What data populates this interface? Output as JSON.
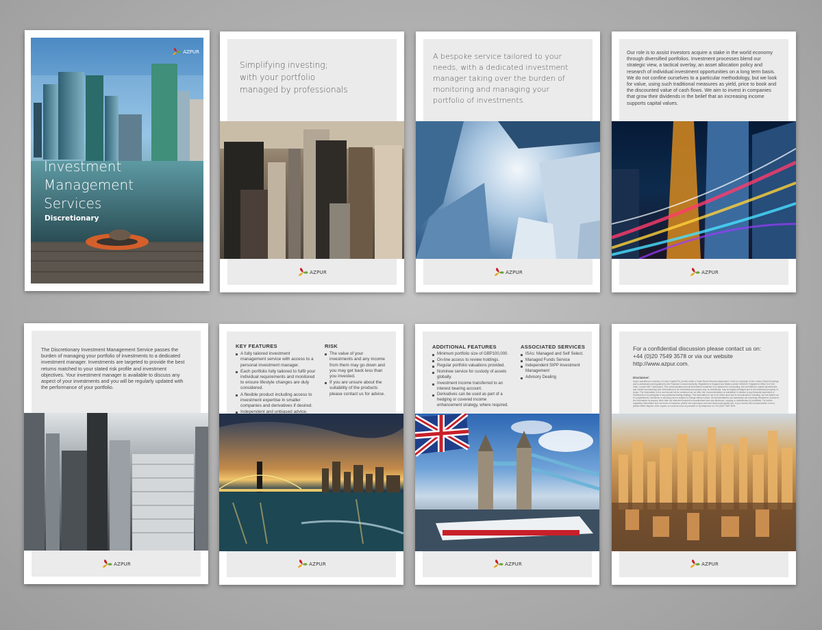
{
  "brand": {
    "logo_text": "AZPUR"
  },
  "cover": {
    "title_lines": [
      "Investment",
      "Management",
      "Services"
    ],
    "subtitle": "Discretionary"
  },
  "page2": {
    "headline_lines": [
      "Simplifying investing;",
      "with your portfolio",
      "managed by professionals"
    ]
  },
  "page3": {
    "headline_lines": [
      "A bespoke service tailored to your",
      "needs, with a dedicated investment",
      "manager taking over the burden of",
      "monitoring and managing your",
      "portfolio of investments."
    ]
  },
  "page4": {
    "text": "Our role is to assist investors acquire a stake in the world economy through diversified portfolios. Investment processes blend our strategic view, a tactical overlay, an asset allocation policy and research of individual investment opportunities on a long term basis. We do not confine ourselves to a particular methodology, but we look for value, using such traditional measures as yield, price to book and the discounted value of cash flows. We aim to invest in companies that grow their dividends in the belief that an increasing income supports capital values."
  },
  "page5": {
    "text": "The Discretionary Investment Management Service passes the burden of managing your portfolio of investments to a dedicated investment manager.  Investments are targeted to provide the best returns matched to your stated risk profile and investment objectives. Your investment manager is available to discuss any aspect of your investments and you will be regularly updated with the performance of your portfolio."
  },
  "page6": {
    "key_features_title": "KEY FEATURES",
    "key_features": [
      "A fully tailored investment management service with access to a personal investment manager.",
      "Each portfolio fully tailored to fulfil your individual requirements and monitored to ensure lifestyle changes are duly considered.",
      "A flexible product including access to investment expertise in smaller companies and derivatives if desired.",
      "Independent and unbiased advice."
    ],
    "risk_title": "RISK",
    "risk": [
      "The value of your investments and any income from them may go down and you may get back less than you invested.",
      "If you are unsure about the suitability of the products please contact us for advice."
    ]
  },
  "page7": {
    "additional_title": "ADDITIONAL FEATURES",
    "additional": [
      "Minimum portfolio size of GBP100,000.",
      "On-line access to review holdings.",
      "Regular portfolio valuations provided.",
      "Nominee service for custody of assets globally.",
      "Investment income transferred to an interest bearing account.",
      "Derivatives can be used as part of a hedging or covered income enhancement strategy, where required."
    ],
    "associated_title": "ASSOCIATED SERVICES",
    "associated": [
      "ISAs: Managed and Self Select.",
      "Managed Funds Service",
      "Independent SIPP Investment Management",
      "Advisory Dealing"
    ]
  },
  "page8": {
    "contact_line1": "For a confidential discussion please contact us on:",
    "contact_line2": "+44 (0)20 7549 3578  or via our website http://www.azpur.com.",
    "disclaimer_title": "Disclaimer:",
    "disclaimer_text": "Azpur operates as a division of Conin Capital Plc (Conin) under a Trade Name Services Agreement. Conin is a member of the London Stock Exchange and is authorised and regulated by the Financial Conduct Authority. Registered in England and Wales number 5361529. Registered Office 8-10 Hill Gate, London W8 7 Authorised. This communication and all information contained in or attached to it (including, but not limited to market prices/levels and market commentary) (the Information) is for informational purposes only, is confidential, may be legally privileged and is the intellectual property of Azpur. The Information is not, and should not be construed as, an offer, bid, recommendation or solicitation in relation to any financial instrument or investment or to participate in any particular trading strategy. This information is not to be relied upon and is not warranted, including, but not limited, as to completeness, timeliness or accuracy and is subject to change without notice. All representations and warranties are expressly disclaimed. Access to the Information by anyone other than the intended recipient is unauthorised and any disclosure, copying or redistribution is prohibited. For further regulatory information and our terms of business, please see www.azpur.com and www.conincapital.com. If you receive this communication in error, please either dispose of the copies or e-mail as soon as possible or by telephone on +44 (0)20 7549 3578."
  },
  "colors": {
    "accent_red": "#c8202a",
    "accent_green": "#6aa534",
    "accent_yellow": "#e8a51c",
    "panel_gray": "#ebebeb"
  }
}
